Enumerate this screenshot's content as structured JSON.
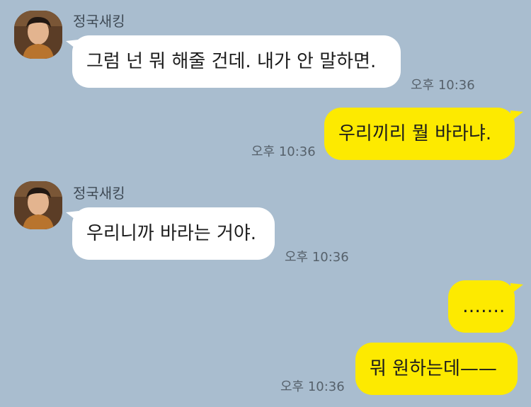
{
  "chat": {
    "messages": [
      {
        "sender": "정국새킹",
        "text": "그럼 넌 뭐 해줄 건데. 내가 안 말하면.",
        "time": "오후 10:36"
      },
      {
        "text": "우리끼리 뭘 바라냐.",
        "time": "오후 10:36"
      },
      {
        "sender": "정국새킹",
        "text": "우리니까 바라는 거야.",
        "time": "오후 10:36"
      },
      {
        "text": "……."
      },
      {
        "text": "뭐 원하는데——",
        "time": "오후 10:36"
      }
    ]
  },
  "colors": {
    "background": "#a9bdcf",
    "incoming_bubble": "#ffffff",
    "outgoing_bubble": "#fdea00"
  }
}
